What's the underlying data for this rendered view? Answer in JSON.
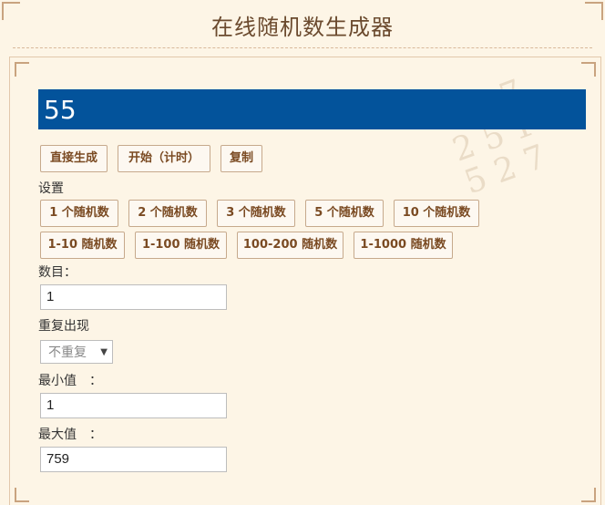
{
  "header": {
    "title": "在线随机数生成器"
  },
  "result": {
    "value": "55"
  },
  "actions": {
    "direct": "直接生成",
    "start": "开始（计时）",
    "copy": "复制"
  },
  "settings": {
    "label": "设置",
    "count_presets": [
      "1 个随机数",
      "2 个随机数",
      "3 个随机数",
      "5 个随机数",
      "10 个随机数"
    ],
    "range_presets": [
      "1-10 随机数",
      "1-100 随机数",
      "100-200 随机数",
      "1-1000 随机数"
    ]
  },
  "form": {
    "count_label": "数目：",
    "count_value": "1",
    "repeat_label": "重复出现",
    "repeat_selected": "不重复",
    "min_label": "最小值　：",
    "min_value": "1",
    "max_label": "最大值　：",
    "max_value": "759"
  }
}
